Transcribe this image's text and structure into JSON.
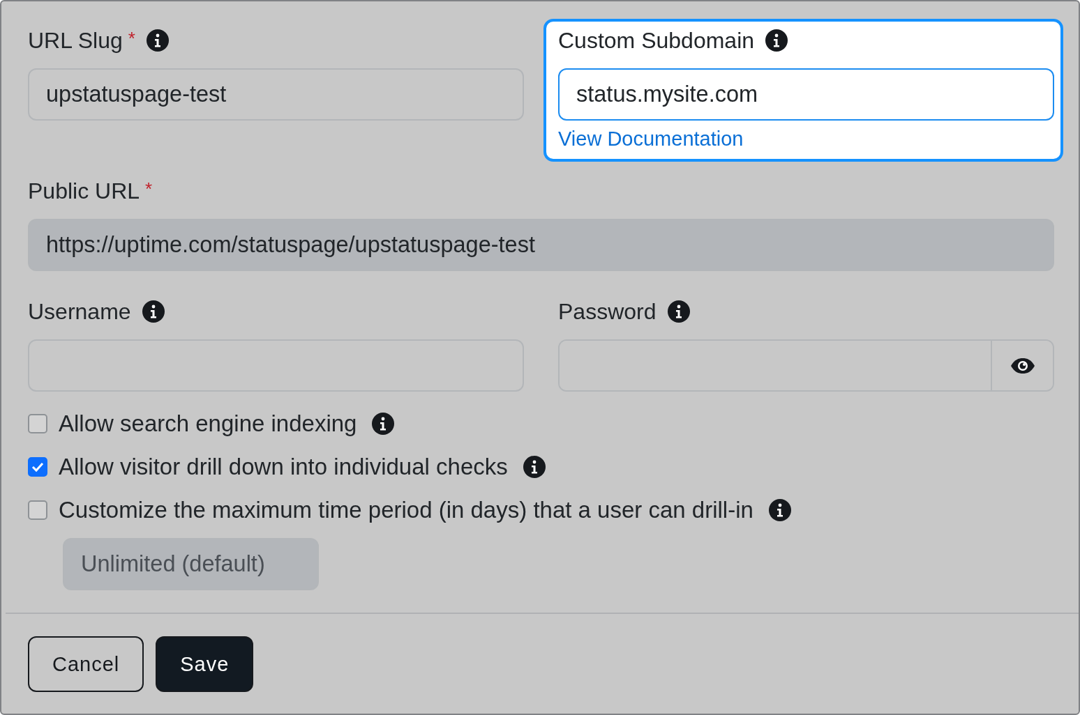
{
  "url_slug": {
    "label": "URL Slug",
    "required_mark": "*",
    "info": true,
    "value": "upstatuspage-test"
  },
  "custom_subdomain": {
    "label": "Custom Subdomain",
    "info": true,
    "value": "status.mysite.com",
    "link": "View Documentation",
    "highlighted": true
  },
  "public_url": {
    "label": "Public URL",
    "required_mark": "*",
    "value": "https://uptime.com/statuspage/upstatuspage-test",
    "disabled": true
  },
  "username": {
    "label": "Username",
    "info": true
  },
  "password": {
    "label": "Password",
    "info": true
  },
  "options": [
    {
      "label": "Allow search engine indexing",
      "checked": false,
      "info": true
    },
    {
      "label": "Allow visitor drill down into individual checks",
      "checked": true,
      "info": true
    },
    {
      "label": "Customize the maximum time period (in days) that a user can drill-in",
      "checked": false,
      "info": true
    }
  ],
  "max_days": {
    "value": "Unlimited (default)",
    "disabled": true
  },
  "buttons": [
    {
      "label": "Cancel",
      "kind": "secondary"
    },
    {
      "label": "Save",
      "kind": "primary"
    }
  ]
}
